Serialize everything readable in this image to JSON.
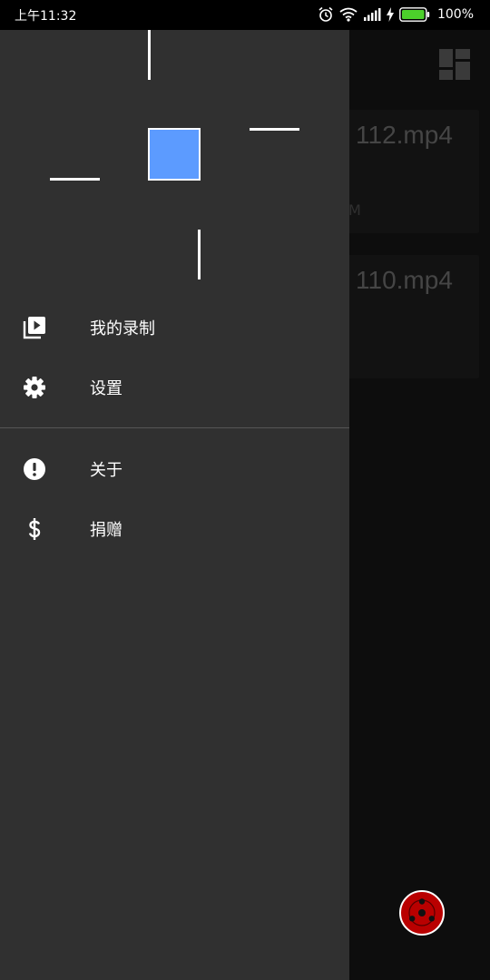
{
  "status_bar": {
    "time": "上午11:32",
    "battery": "100%"
  },
  "main": {
    "cards": [
      {
        "name": "112.mp4",
        "meta": "M"
      },
      {
        "name": "110.mp4",
        "meta": ""
      }
    ]
  },
  "drawer": {
    "items": [
      {
        "label": "我的录制",
        "icon": "video-library-icon"
      },
      {
        "label": "设置",
        "icon": "gear-icon"
      },
      {
        "label": "关于",
        "icon": "info-alert-icon"
      },
      {
        "label": "捐赠",
        "icon": "dollar-icon"
      }
    ]
  },
  "colors": {
    "drawer_bg": "#303030",
    "main_bg": "#141414",
    "logo_square": "#5c9bff",
    "fab": "#b90000",
    "battery": "#4cd02b"
  }
}
